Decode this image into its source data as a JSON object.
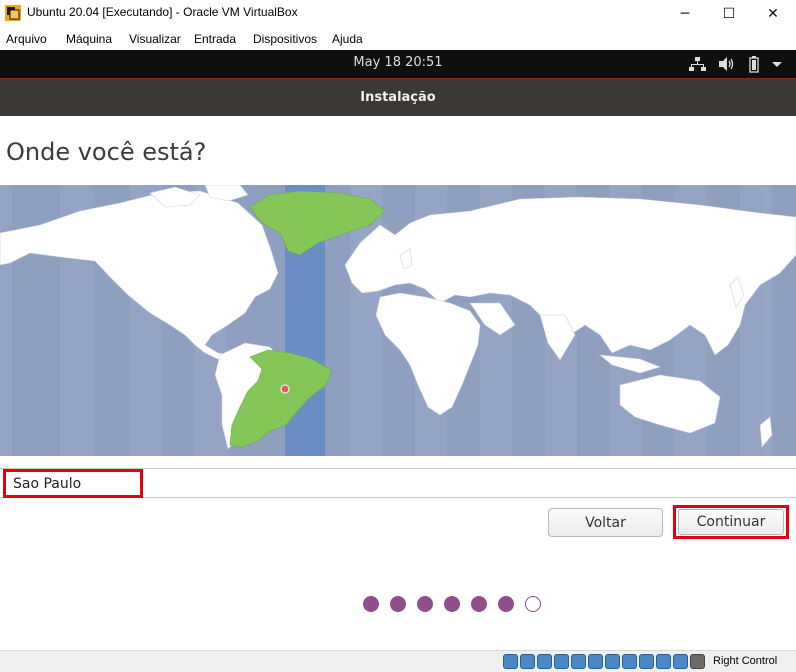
{
  "window": {
    "title": "Ubuntu 20.04 [Executando] - Oracle VM VirtualBox",
    "minimize": "─",
    "maximize": "☐",
    "close": "✕"
  },
  "menubar": {
    "items": [
      "Arquivo",
      "Máquina",
      "Visualizar",
      "Entrada",
      "Dispositivos",
      "Ajuda"
    ]
  },
  "topbar": {
    "clock": "May 18  20:51",
    "tray_icons": [
      "network-icon",
      "volume-icon",
      "battery-icon",
      "menu-arrow-icon"
    ]
  },
  "installer": {
    "header_title": "Instalação",
    "heading": "Onde você está?",
    "city_value": "Sao Paulo",
    "back_label": "Voltar",
    "continue_label": "Continuar",
    "progress": {
      "total": 7,
      "completed": 6
    }
  },
  "statusbar": {
    "host_key_label": "Right Control",
    "icons": [
      "hard-disk-icon",
      "optical-drive-icon",
      "audio-icon",
      "network-icon",
      "usb-icon",
      "shared-folders-icon",
      "display-icon",
      "recording-icon",
      "video-capture-icon",
      "cpu-icon",
      "mouse-integration-icon",
      "host-key-icon"
    ]
  },
  "colors": {
    "map_ocean": "#8f9fc0",
    "map_land": "#ffffff",
    "selected_zone": "#6b8cc4",
    "selected_land": "#84c758",
    "accent_dot": "#924d8b",
    "highlight": "#e3000f"
  }
}
